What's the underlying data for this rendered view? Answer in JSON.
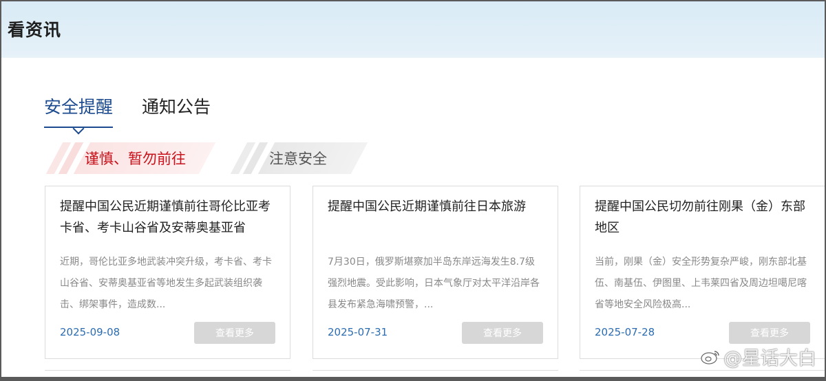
{
  "page": {
    "title": "看资讯"
  },
  "tabs": [
    {
      "label": "安全提醒",
      "active": true
    },
    {
      "label": "通知公告",
      "active": false
    }
  ],
  "filters": [
    {
      "label": "谨慎、暂勿前往",
      "color": "#c8121b"
    },
    {
      "label": "注意安全",
      "color": "#555555"
    }
  ],
  "cards": [
    {
      "title": "提醒中国公民近期谨慎前往哥伦比亚考卡省、考卡山谷省及安蒂奥基亚省",
      "desc": "近期，哥伦比亚多地武装冲突升级，考卡省、考卡山谷省、安蒂奥基亚省等地发生多起武装组织袭击、绑架事件，造成数...",
      "date": "2025-09-08",
      "button": "查看更多"
    },
    {
      "title": "提醒中国公民近期谨慎前往日本旅游",
      "desc": "7月30日，俄罗斯堪察加半岛东岸远海发生8.7级强烈地震。受此影响，日本气象厅对太平洋沿岸各县发布紧急海啸预警，...",
      "date": "2025-07-31",
      "button": "查看更多"
    },
    {
      "title": "提醒中国公民切勿前往刚果（金）东部地区",
      "desc": "当前，刚果（金）安全形势复杂严峻，刚东部北基伍、南基伍、伊图里、上韦莱四省及周边坦噶尼喀省等地安全风险极高...",
      "date": "2025-07-28",
      "button": "查看更多"
    }
  ],
  "watermark": {
    "text": "@星话大白",
    "icon": "weibo-icon"
  },
  "colors": {
    "accent": "#1c4a8e",
    "alert": "#c8121b",
    "date": "#2b6cb0"
  }
}
